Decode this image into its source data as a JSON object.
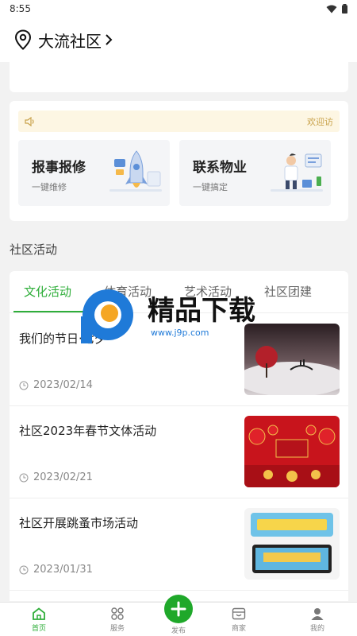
{
  "status_bar": {
    "time": "8:55"
  },
  "header": {
    "location": "大流社区"
  },
  "notice": {
    "text": "欢迎访"
  },
  "services": [
    {
      "title": "报事报修",
      "subtitle": "一键维修"
    },
    {
      "title": "联系物业",
      "subtitle": "一键搞定"
    }
  ],
  "section": {
    "title": "社区活动"
  },
  "tabs": [
    {
      "label": "文化活动"
    },
    {
      "label": "体育活动"
    },
    {
      "label": "艺术活动"
    },
    {
      "label": "社区团建"
    }
  ],
  "activities": [
    {
      "title": "我们的节日·七夕",
      "date": "2023/02/14"
    },
    {
      "title": "社区2023年春节文体活动",
      "date": "2023/02/21"
    },
    {
      "title": "社区开展跳蚤市场活动",
      "date": "2023/01/31"
    }
  ],
  "watermark": {
    "brand": "精品下载",
    "url": "www.j9p.com"
  },
  "tabbar": {
    "home": "首页",
    "services": "服务",
    "publish": "发布",
    "merchant": "商家",
    "mine": "我的"
  },
  "colors": {
    "accent": "#2fae3a",
    "publish": "#1fa82a",
    "notice_bg": "#fdf6e3"
  }
}
